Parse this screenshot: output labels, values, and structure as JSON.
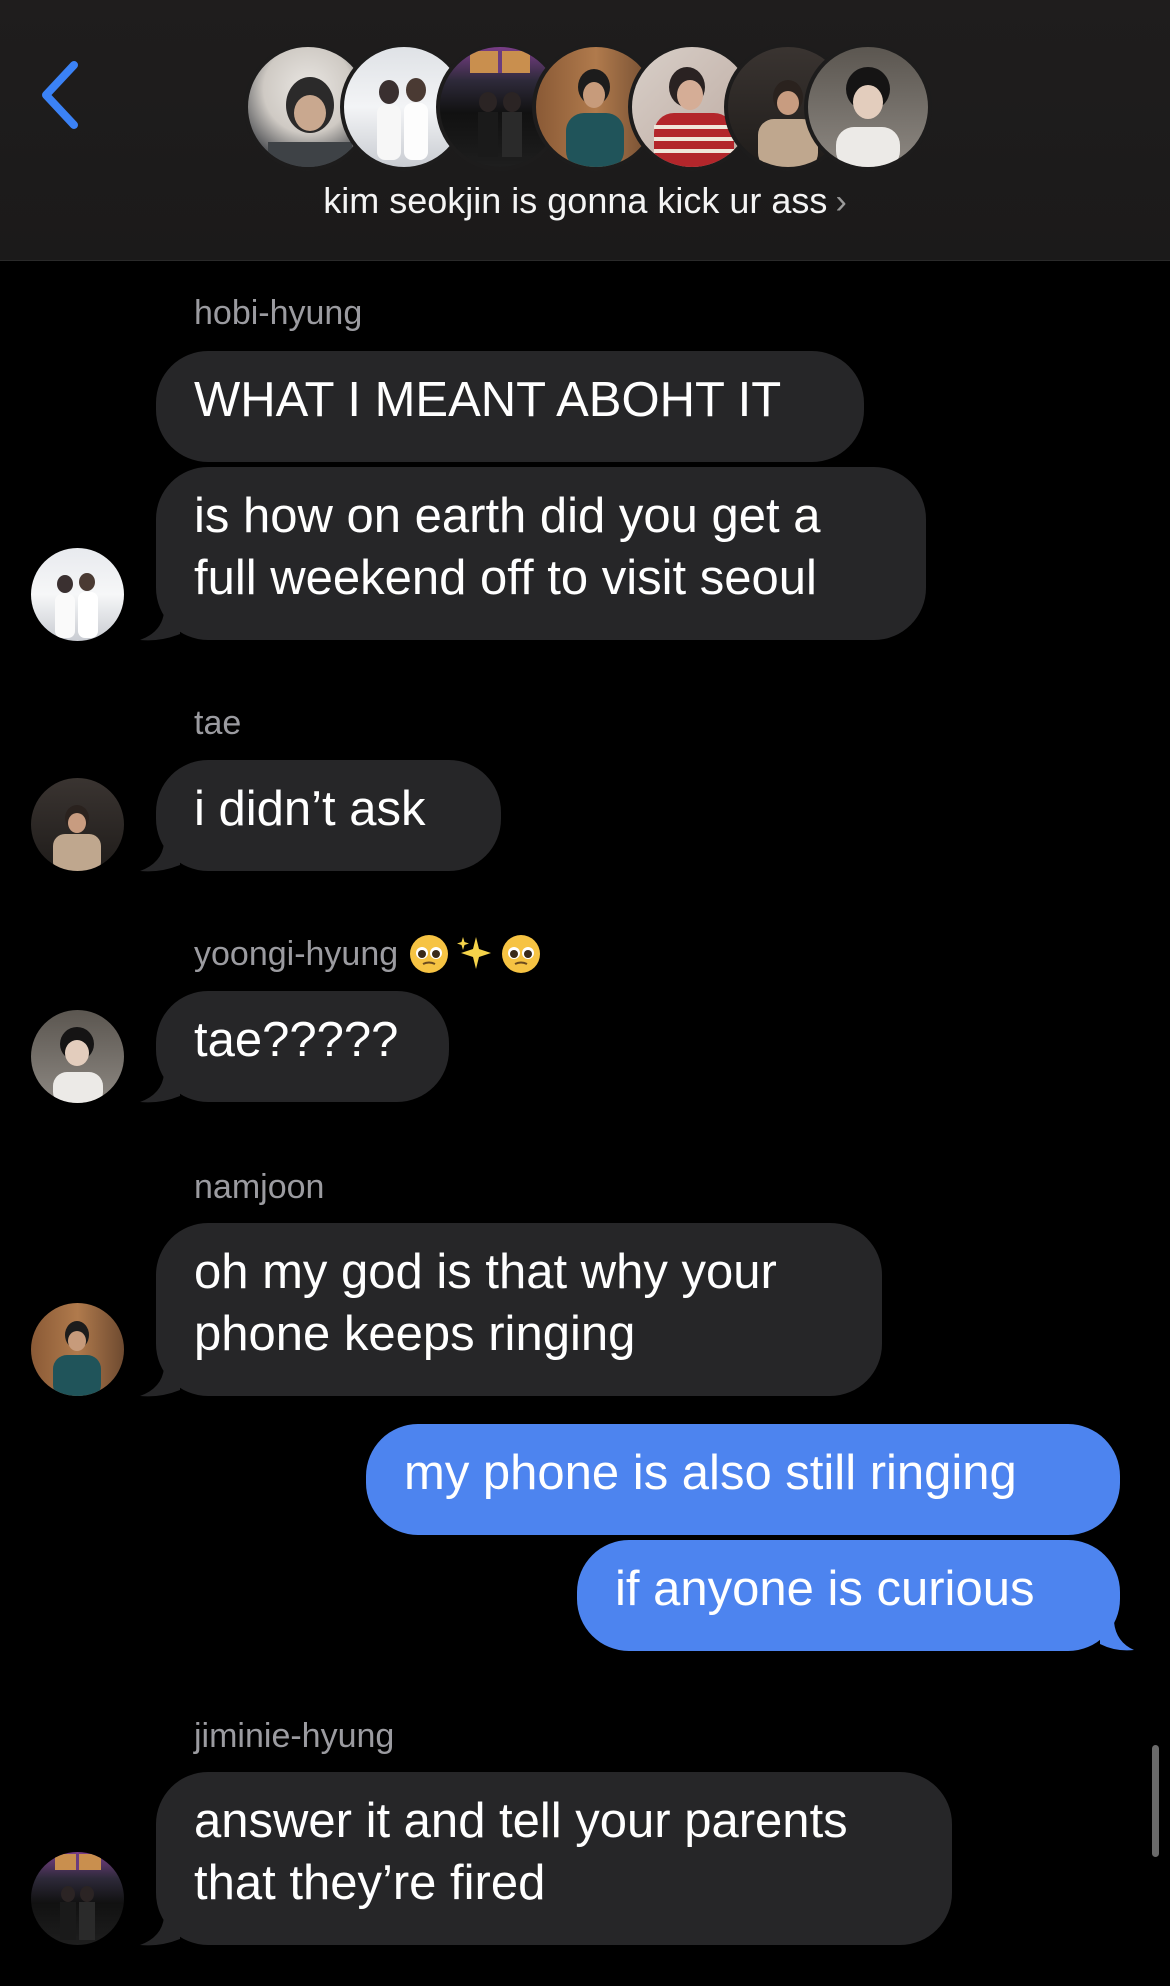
{
  "header": {
    "group_name": "kim seokjin is gonna kick ur ass",
    "chevron": "›",
    "back_icon": "chevron-left-icon",
    "accent": "#3b82f6"
  },
  "messages": [
    {
      "sender": "hobi-hyung",
      "lines": [
        "WHAT I MEANT ABOHT IT"
      ]
    },
    {
      "lines": [
        "is how on earth did you get a",
        "full weekend off to visit seoul"
      ]
    },
    {
      "sender": "tae",
      "lines": [
        "i didn’t ask"
      ]
    },
    {
      "sender": "yoongi-hyung",
      "sender_emoji": "🥺✨🥺",
      "lines": [
        "tae?????"
      ]
    },
    {
      "sender": "namjoon",
      "lines": [
        "oh my god is that why your",
        "phone keeps ringing"
      ]
    },
    {
      "outgoing": true,
      "lines": [
        "my phone is also still ringing"
      ]
    },
    {
      "outgoing": true,
      "lines": [
        "if anyone is curious"
      ]
    },
    {
      "sender": "jiminie-hyung",
      "lines": [
        "answer it and tell your parents",
        "that they’re fired"
      ]
    }
  ],
  "colors": {
    "incoming_bubble": "#262628",
    "outgoing_bubble": "#4d84ef",
    "sender_text": "#9b9ba0"
  }
}
